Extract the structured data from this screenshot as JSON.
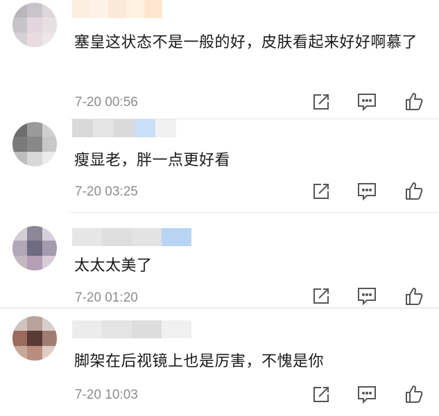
{
  "comments": [
    {
      "text": "塞皇这状态不是一般的好，皮肤看起来好好啊慕了",
      "time": "7-20 00:56"
    },
    {
      "text": "瘦显老，胖一点更好看",
      "time": "7-20 03:25"
    },
    {
      "text": "太太太美了",
      "time": "7-20 01:20"
    },
    {
      "text": "脚架在后视镜上也是厉害，不愧是你",
      "time": "7-20 10:03"
    }
  ],
  "icons": {
    "share": "share-icon",
    "reply": "comment-icon",
    "like": "thumbs-up-icon"
  },
  "colors": {
    "text": "#1a1a1a",
    "timestamp": "#8c8c8c",
    "icon": "#555555",
    "divider": "#e6e6e6"
  }
}
